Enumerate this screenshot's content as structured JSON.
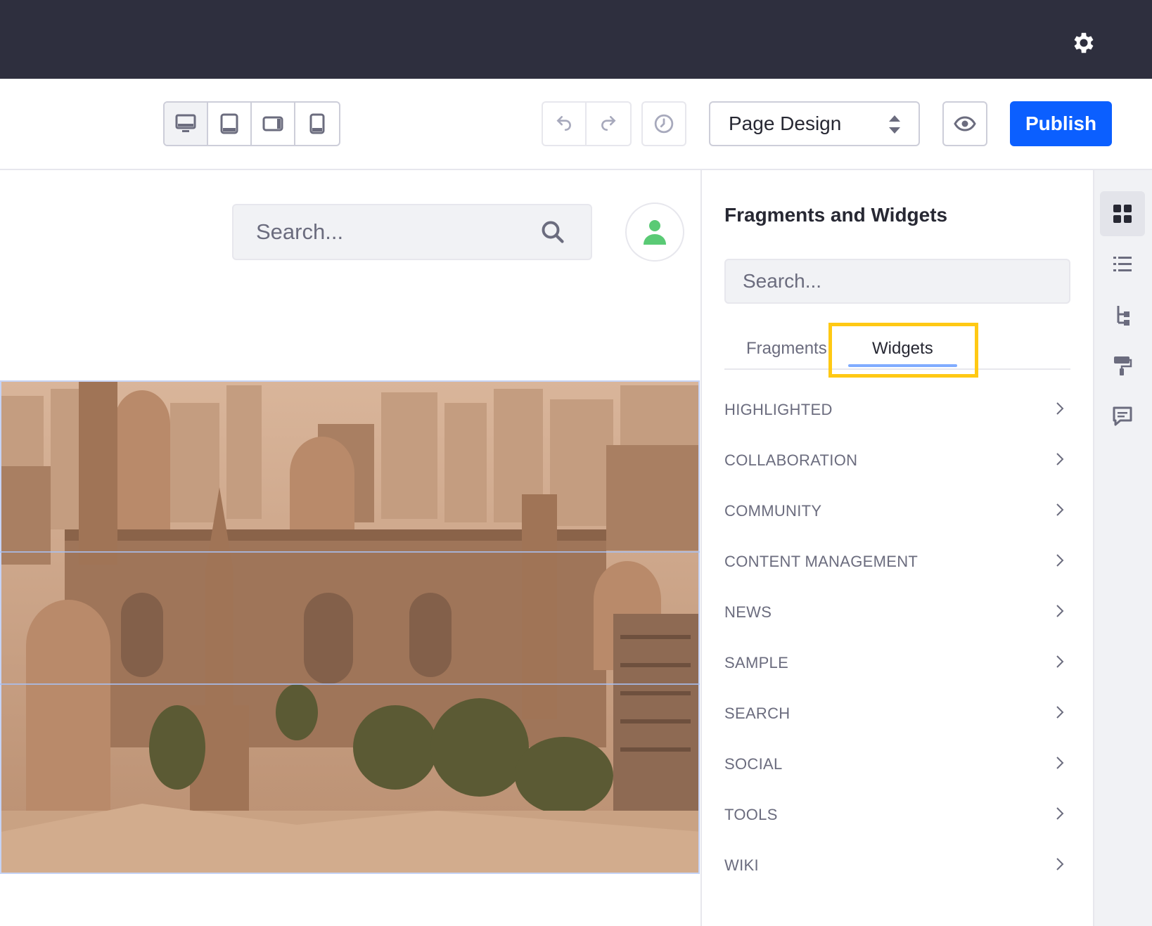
{
  "header": {
    "settings_icon": "gear-icon"
  },
  "toolbar": {
    "viewports": [
      {
        "name": "desktop",
        "icon": "desktop-icon",
        "active": true
      },
      {
        "name": "tablet",
        "icon": "tablet-icon",
        "active": false
      },
      {
        "name": "landscape-phone",
        "icon": "landscape-phone-icon",
        "active": false
      },
      {
        "name": "portrait-phone",
        "icon": "portrait-phone-icon",
        "active": false
      }
    ],
    "undo_icon": "undo-icon",
    "redo_icon": "redo-icon",
    "history_icon": "clock-icon",
    "experience_select": "Page Design",
    "preview_icon": "eye-icon",
    "publish_label": "Publish"
  },
  "canvas": {
    "search_placeholder": "Search...",
    "search_icon": "search-icon",
    "avatar_icon": "user-icon",
    "hero_image": "cairo-mosque-cityscape"
  },
  "sidebar": {
    "title": "Fragments and Widgets",
    "search_placeholder": "Search...",
    "tabs": [
      {
        "label": "Fragments",
        "active": false
      },
      {
        "label": "Widgets",
        "active": true
      }
    ],
    "categories": [
      {
        "label": "HIGHLIGHTED"
      },
      {
        "label": "COLLABORATION"
      },
      {
        "label": "COMMUNITY"
      },
      {
        "label": "CONTENT MANAGEMENT"
      },
      {
        "label": "NEWS"
      },
      {
        "label": "SAMPLE"
      },
      {
        "label": "SEARCH"
      },
      {
        "label": "SOCIAL"
      },
      {
        "label": "TOOLS"
      },
      {
        "label": "WIKI"
      }
    ]
  },
  "rail": {
    "buttons": [
      {
        "icon": "grid-icon",
        "active": true
      },
      {
        "icon": "list-icon",
        "active": false
      },
      {
        "icon": "tree-icon",
        "active": false
      },
      {
        "icon": "paint-roller-icon",
        "active": false
      },
      {
        "icon": "comment-icon",
        "active": false
      }
    ]
  },
  "colors": {
    "topbar": "#2e2f3e",
    "primary": "#0b5fff",
    "highlight": "#ffc914",
    "avatar": "#5aca75"
  }
}
